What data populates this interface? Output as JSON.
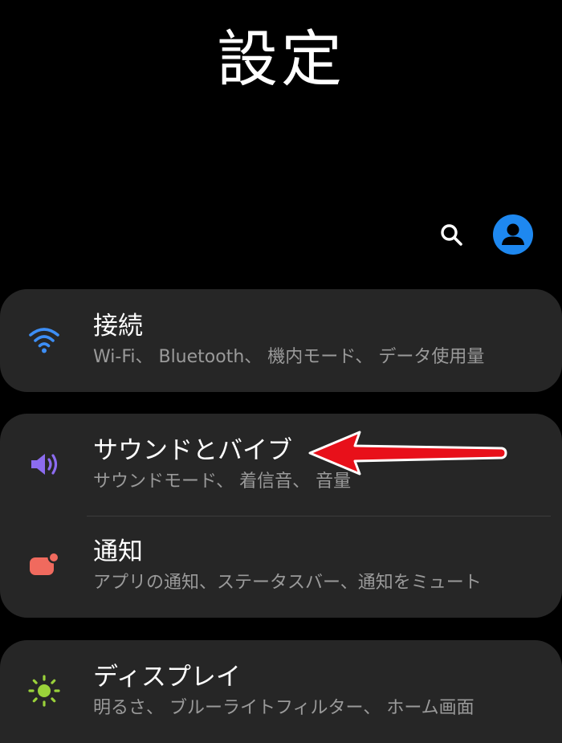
{
  "page": {
    "title": "設定"
  },
  "header": {
    "search_icon": "search-icon",
    "profile_icon": "person-icon"
  },
  "groups": [
    {
      "items": [
        {
          "icon": "wifi-icon",
          "icon_color": "#3d8ef5",
          "title": "接続",
          "subtitle": "Wi-Fi、 Bluetooth、 機内モード、 データ使用量"
        }
      ]
    },
    {
      "items": [
        {
          "icon": "speaker-icon",
          "icon_color": "#8c6cf0",
          "title": "サウンドとバイブ",
          "subtitle": "サウンドモード、 着信音、 音量"
        },
        {
          "icon": "notification-icon",
          "icon_color": "#f06a5e",
          "title": "通知",
          "subtitle": "アプリの通知、ステータスバー、通知をミュート"
        }
      ]
    },
    {
      "items": [
        {
          "icon": "brightness-icon",
          "icon_color": "#9ad23a",
          "title": "ディスプレイ",
          "subtitle": "明るさ、 ブルーライトフィルター、 ホーム画面"
        }
      ]
    }
  ],
  "colors": {
    "background": "#000000",
    "card": "#262626",
    "subtitle_text": "#9a9a9a",
    "avatar": "#1e88f0",
    "annotation_arrow": "#e8101a"
  }
}
